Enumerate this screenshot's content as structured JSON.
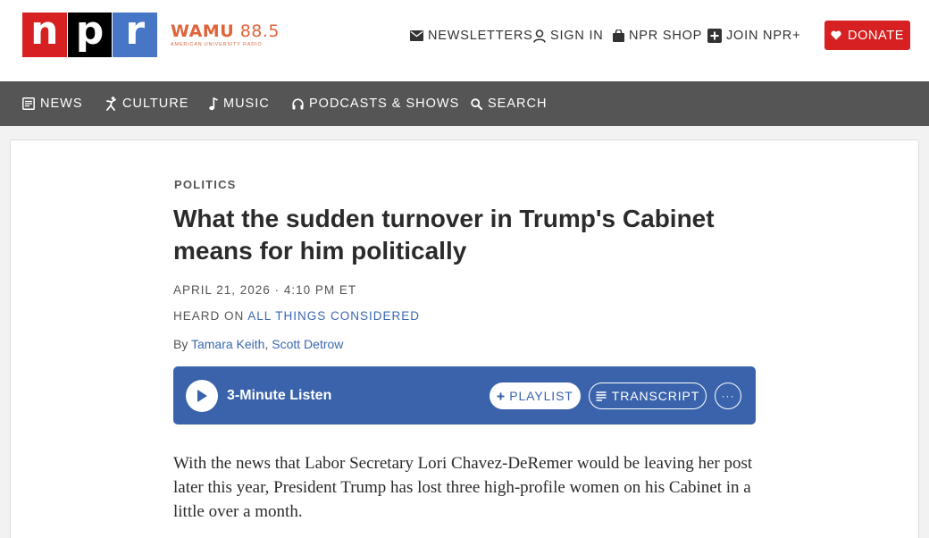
{
  "brand": {
    "logo_letters": [
      "n",
      "p",
      "r"
    ],
    "logo_colors": [
      "#d62021",
      "#000000",
      "#4876c6"
    ],
    "station_call": "WAMU",
    "station_freq": "88.5",
    "station_tagline": "AMERICAN UNIVERSITY RADIO",
    "station_color": "#e0643b"
  },
  "utility_nav": {
    "newsletters": "NEWSLETTERS",
    "sign_in": "SIGN IN",
    "shop": "NPR SHOP",
    "join": "JOIN NPR+",
    "donate": "DONATE",
    "donate_color": "#d62021"
  },
  "main_nav": {
    "items": [
      {
        "label": "NEWS",
        "icon": "newspaper-icon"
      },
      {
        "label": "CULTURE",
        "icon": "dancer-icon"
      },
      {
        "label": "MUSIC",
        "icon": "music-note-icon"
      },
      {
        "label": "PODCASTS & SHOWS",
        "icon": "headphones-icon"
      },
      {
        "label": "SEARCH",
        "icon": "search-icon"
      }
    ]
  },
  "article": {
    "section": "POLITICS",
    "headline": "What the sudden turnover in Trump's Cabinet means for him politically",
    "dateline": "APRIL 21, 2026 · 4:10 PM ET",
    "heard_on_prefix": "HEARD ON ",
    "heard_on_show": "ALL THINGS CONSIDERED",
    "byline_prefix": "By ",
    "authors": [
      "Tamara Keith",
      "Scott Detrow"
    ],
    "author_separator": ", ",
    "body_first_paragraph": "With the news that Labor Secretary Lori Chavez-DeRemer would be leaving her post later this year, President Trump has lost three high-profile women on his Cabinet in a little over a month."
  },
  "player": {
    "listen_label": "3-Minute Listen",
    "playlist_label": "PLAYLIST",
    "transcript_label": "TRANSCRIPT",
    "more_label": "···",
    "accent": "#3a63ab"
  }
}
